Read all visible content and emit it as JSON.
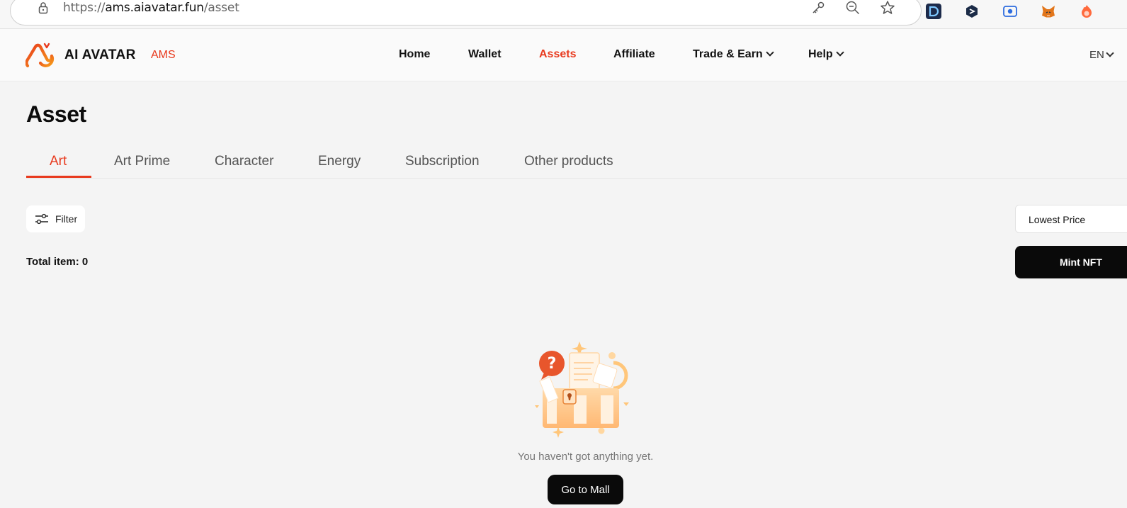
{
  "browser": {
    "url_prefix": "https://",
    "url_host": "ams.aiavatar.fun",
    "url_path": "/asset"
  },
  "header": {
    "brand_name": "AI AVATAR",
    "brand_tag": "AMS",
    "nav": [
      {
        "label": "Home"
      },
      {
        "label": "Wallet"
      },
      {
        "label": "Assets"
      },
      {
        "label": "Affiliate"
      },
      {
        "label": "Trade & Earn"
      },
      {
        "label": "Help"
      }
    ],
    "active_nav": "Assets",
    "language": "EN"
  },
  "page": {
    "title": "Asset",
    "tabs": [
      {
        "label": "Art"
      },
      {
        "label": "Art Prime"
      },
      {
        "label": "Character"
      },
      {
        "label": "Energy"
      },
      {
        "label": "Subscription"
      },
      {
        "label": "Other products"
      }
    ],
    "active_tab": "Art",
    "filter_label": "Filter",
    "sort_value": "Lowest Price",
    "total_label": "Total item: 0",
    "mint_label": "Mint NFT",
    "empty_message": "You haven't got anything yet.",
    "mall_button": "Go to Mall"
  },
  "colors": {
    "accent": "#e8391d",
    "button_dark": "#0a0a0a",
    "page_bg": "#f4f4f4"
  },
  "icons": {
    "lock": "lock-icon",
    "key": "key-icon",
    "zoom_out": "zoom-out-icon",
    "star": "star-icon",
    "filter": "sliders-icon"
  }
}
